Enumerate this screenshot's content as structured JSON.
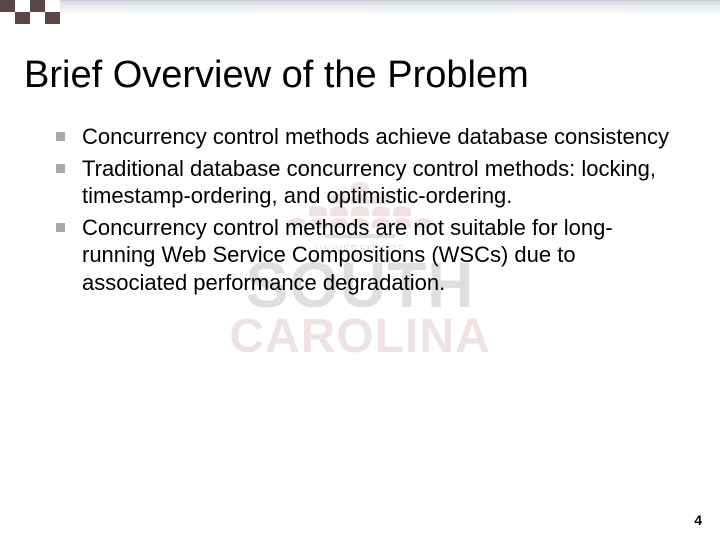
{
  "watermark": {
    "line1": "UNIVERSITY OF",
    "line2": "SOUTH",
    "line3": "CAROLINA"
  },
  "slide": {
    "title": "Brief Overview of the Problem",
    "bullets": [
      "Concurrency control methods achieve database consistency",
      "Traditional database concurrency control methods: locking, timestamp-ordering, and optimistic-ordering.",
      "Concurrency control methods are not suitable for long-running Web Service Compositions (WSCs) due to associated performance degradation."
    ],
    "page_number": "4"
  }
}
